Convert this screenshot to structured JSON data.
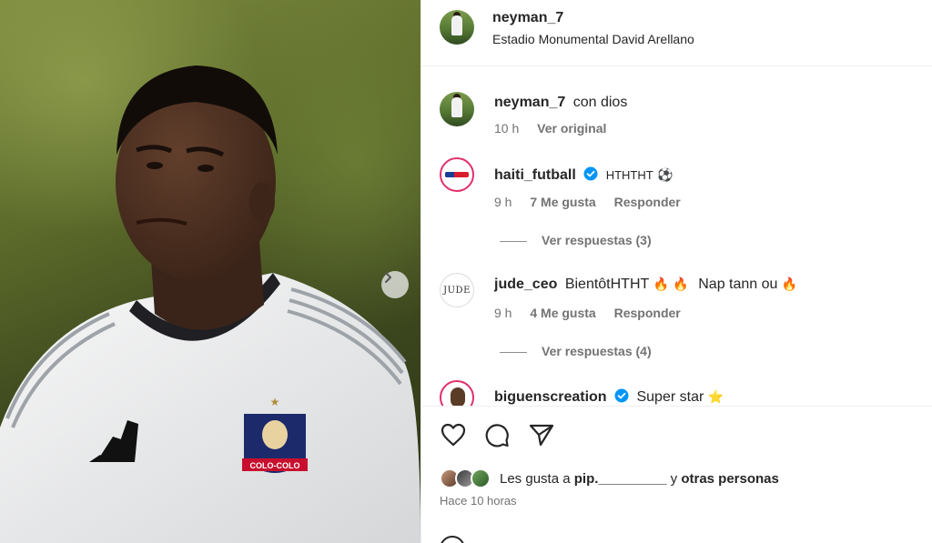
{
  "post": {
    "author": "neyman_7",
    "location": "Estadio Monumental David Arellano",
    "next_icon": "chevron-right-icon",
    "badge_text": "COLO-COLO"
  },
  "caption": {
    "user": "neyman_7",
    "text": "con dios",
    "time": "10 h",
    "translate": "Ver original"
  },
  "comments": [
    {
      "user": "haiti_futball",
      "verified": true,
      "text": "HTHTHT",
      "emoji": "⚽",
      "time": "9 h",
      "likes": "7 Me gusta",
      "reply": "Responder",
      "view_replies": "Ver respuestas (3)"
    },
    {
      "user": "jude_ceo",
      "verified": false,
      "text": "BientôtHTHT",
      "emoji": "🔥 🔥",
      "text2": "Nap tann ou",
      "emoji2": "🔥",
      "avatar_text": "JUDE",
      "time": "9 h",
      "likes": "4 Me gusta",
      "reply": "Responder",
      "view_replies": "Ver respuestas (4)"
    },
    {
      "user": "biguenscreation",
      "verified": true,
      "text": "Super star",
      "emoji": "⭐"
    }
  ],
  "actions": {
    "like_icon": "heart-icon",
    "comment_icon": "comment-icon",
    "share_icon": "send-icon",
    "likes_prefix": "Les gusta a",
    "likes_user": "pip._________",
    "likes_join": "y",
    "likes_others": "otras personas",
    "time_ago": "Hace 10 horas"
  },
  "colors": {
    "verified": "#0095f6",
    "text": "#262626",
    "muted": "#737373",
    "divider": "#efefef"
  }
}
